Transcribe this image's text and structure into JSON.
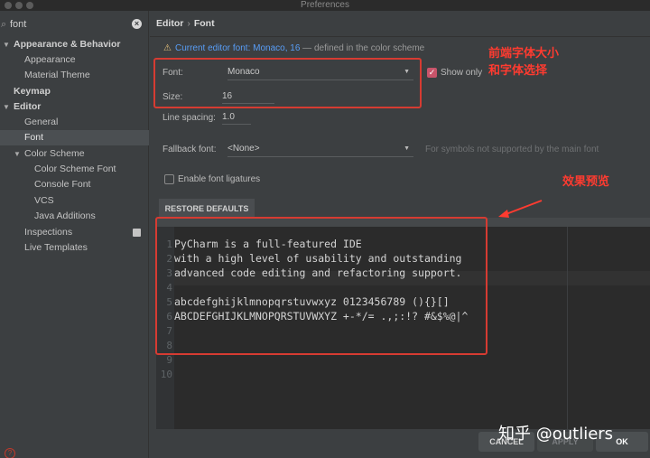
{
  "window": {
    "title": "Preferences"
  },
  "search": {
    "value": "font"
  },
  "sidebar": {
    "items": [
      {
        "label": "Appearance & Behavior",
        "expanded": true
      },
      {
        "label": "Appearance"
      },
      {
        "label": "Material Theme"
      },
      {
        "label": "Keymap"
      },
      {
        "label": "Editor",
        "expanded": true
      },
      {
        "label": "General"
      },
      {
        "label": "Font",
        "selected": true
      },
      {
        "label": "Color Scheme",
        "expanded": true
      },
      {
        "label": "Color Scheme Font"
      },
      {
        "label": "Console Font"
      },
      {
        "label": "VCS"
      },
      {
        "label": "Java Additions"
      },
      {
        "label": "Inspections"
      },
      {
        "label": "Live Templates"
      }
    ]
  },
  "breadcrumb": {
    "parent": "Editor",
    "separator": "›",
    "current": "Font"
  },
  "notice": {
    "icon": "warning-icon",
    "link": "Current editor font: Monaco, 16",
    "rest": " — defined in the color scheme"
  },
  "form": {
    "font_label": "Font:",
    "font_value": "Monaco",
    "show_only_label": "Show only",
    "show_only_checked": true,
    "size_label": "Size:",
    "size_value": "16",
    "line_spacing_label": "Line spacing:",
    "line_spacing_value": "1.0",
    "fallback_label": "Fallback font:",
    "fallback_value": "<None>",
    "fallback_hint": "For symbols not supported by the main font",
    "ligatures_label": "Enable font ligatures",
    "ligatures_checked": false
  },
  "restore_defaults": "RESTORE DEFAULTS",
  "preview": {
    "line_numbers": [
      "1",
      "2",
      "3",
      "4",
      "5",
      "6",
      "7",
      "8",
      "9",
      "10"
    ],
    "lines": [
      "PyCharm is a full-featured IDE",
      "with a high level of usability and outstanding",
      "advanced code editing and refactoring support.",
      "",
      "abcdefghijklmnopqrstuvwxyz 0123456789 (){}[]",
      "ABCDEFGHIJKLMNOPQRSTUVWXYZ +-*/= .,;:!? #&$%@|^",
      "",
      "",
      "",
      ""
    ]
  },
  "buttons": {
    "cancel": "CANCEL",
    "apply": "APPLY",
    "ok": "OK"
  },
  "annotations": {
    "font_select": "前端字体大小\n和字体选择",
    "preview": "效果预览"
  },
  "watermark": "知乎 @outliers",
  "colors": {
    "annotation_red": "#d63b32",
    "link_blue": "#589df6",
    "checkbox_pink": "#c8546a"
  }
}
